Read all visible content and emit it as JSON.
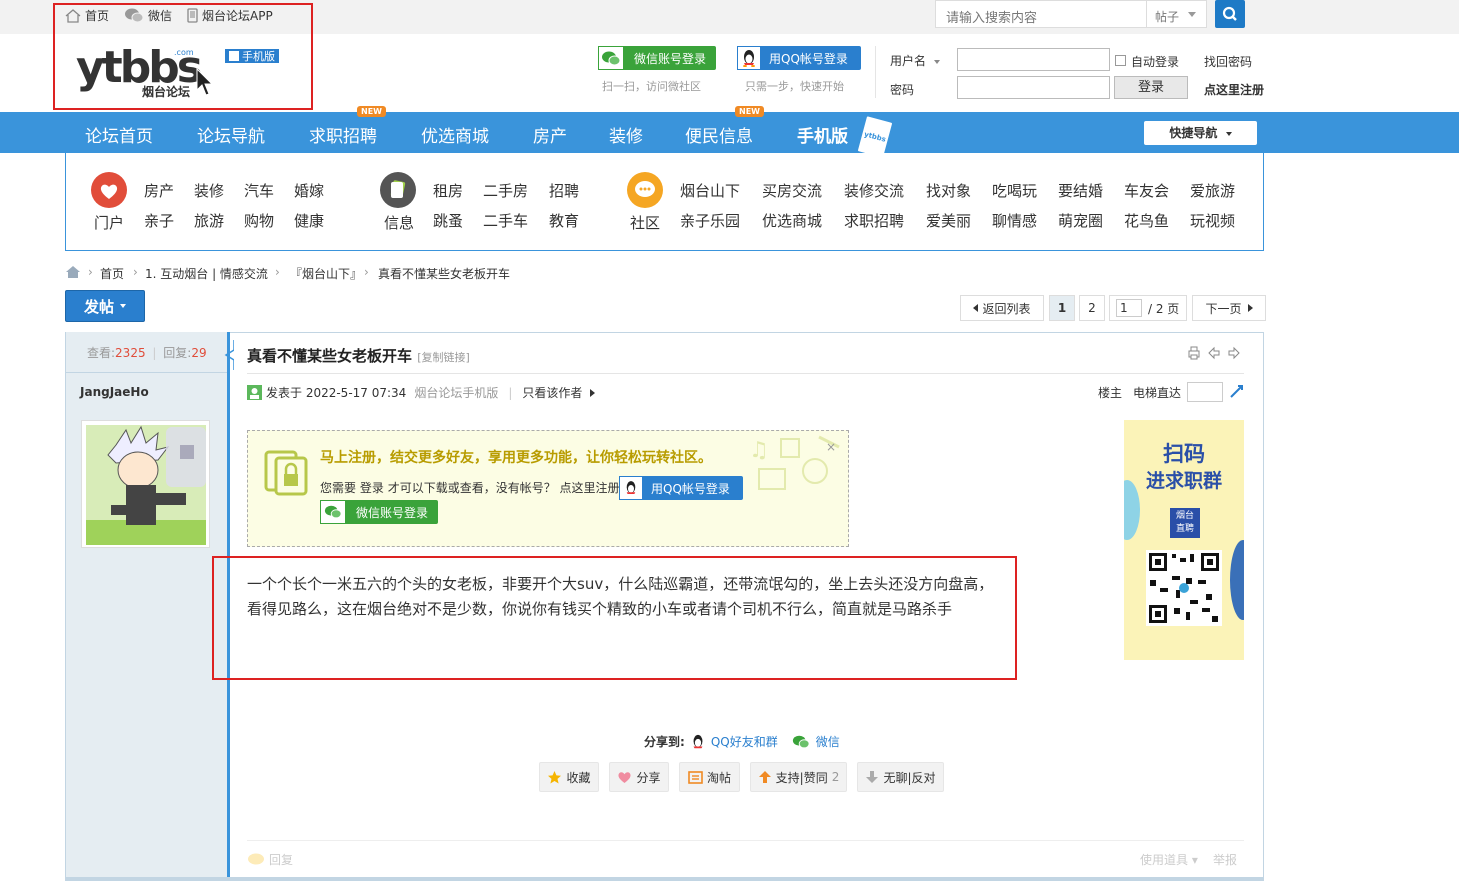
{
  "topbar": {
    "home": "首页",
    "wechat": "微信",
    "app": "烟台论坛APP",
    "search_placeholder": "请输入搜索内容",
    "search_type": "帖子"
  },
  "header": {
    "logo_text": "ytbbs",
    "logo_sub": "烟台论坛",
    "logo_com": ".com",
    "mobile_tag": "手机版",
    "wechat_login": "微信账号登录",
    "wechat_hint": "扫一扫，访问微社区",
    "qq_login": "用QQ帐号登录",
    "qq_hint": "只需一步，快速开始",
    "username_label": "用户名",
    "password_label": "密码",
    "auto_login": "自动登录",
    "find_password": "找回密码",
    "login_button": "登录",
    "register": "点这里注册"
  },
  "nav": {
    "items": [
      "论坛首页",
      "论坛导航",
      "求职招聘",
      "优选商城",
      "房产",
      "装修",
      "便民信息",
      "手机版"
    ],
    "new_tag": "NEW",
    "mobile_badge": "ytbbs",
    "quick_nav": "快捷导航"
  },
  "subnav": {
    "group1": {
      "label": "门户",
      "links": [
        "房产",
        "装修",
        "汽车",
        "婚嫁",
        "亲子",
        "旅游",
        "购物",
        "健康"
      ]
    },
    "group2": {
      "label": "信息",
      "links": [
        "租房",
        "二手房",
        "招聘",
        "跳蚤",
        "二手车",
        "教育"
      ]
    },
    "group3": {
      "label": "社区",
      "links": [
        "烟台山下",
        "买房交流",
        "装修交流",
        "找对象",
        "吃喝玩",
        "要结婚",
        "车友会",
        "爱旅游",
        "亲子乐园",
        "优选商城",
        "求职招聘",
        "爱美丽",
        "聊情感",
        "萌宠圈",
        "花鸟鱼",
        "玩视频"
      ]
    }
  },
  "breadcrumb": [
    "首页",
    "1. 互动烟台 | 情感交流",
    "『烟台山下』",
    "真看不懂某些女老板开车"
  ],
  "toolbar": {
    "post_button": "发帖",
    "back_to_list": "返回列表",
    "page1": "1",
    "page2": "2",
    "page_input": "1",
    "page_total": "/ 2 页",
    "next_page": "下一页"
  },
  "thread": {
    "views_label": "查看:",
    "views": "2325",
    "replies_label": "回复:",
    "replies": "29",
    "title": "真看不懂某些女老板开车",
    "copy_link": "[复制链接]",
    "author": "JangJaeHo",
    "posted_prefix": "发表于 2022-5-17 07:34",
    "posted_via": "烟台论坛手机版",
    "only_author": "只看该作者",
    "floor": "楼主",
    "elevator": "电梯直达",
    "register_tip": "马上注册，结交更多好友，享用更多功能，让你轻松玩转社区。",
    "login_tip_1": "您需要",
    "login_tip_login": "登录",
    "login_tip_2": "才可以下载或查看，没有帐号？",
    "login_tip_reg": "点这里注册",
    "qq_login": "用QQ帐号登录",
    "wechat_login": "微信账号登录",
    "content": "一个个长个一米五六的个头的女老板，非要开个大suv，什么陆巡霸道，还带流氓勾的，坐上去头还没方向盘高，看得见路么，这在烟台绝对不是少数，你说你有钱买个精致的小车或者请个司机不行么，简直就是马路杀手",
    "ad_line1": "扫码",
    "ad_line2": "进求职群",
    "ad_badge": "烟台\n直聘",
    "share_label": "分享到:",
    "share_qq": "QQ好友和群",
    "share_wechat": "微信",
    "actions": [
      "收藏",
      "分享",
      "淘帖",
      "支持|赞同",
      "无聊|反对"
    ],
    "support_count": "2",
    "reply": "回复",
    "use_tool": "使用道具",
    "report": "举报"
  },
  "colors": {
    "nav_blue": "#3a94db",
    "accent_red": "#e04d3a",
    "wechat_green": "#3aa33a",
    "qq_blue": "#2a7fce"
  }
}
